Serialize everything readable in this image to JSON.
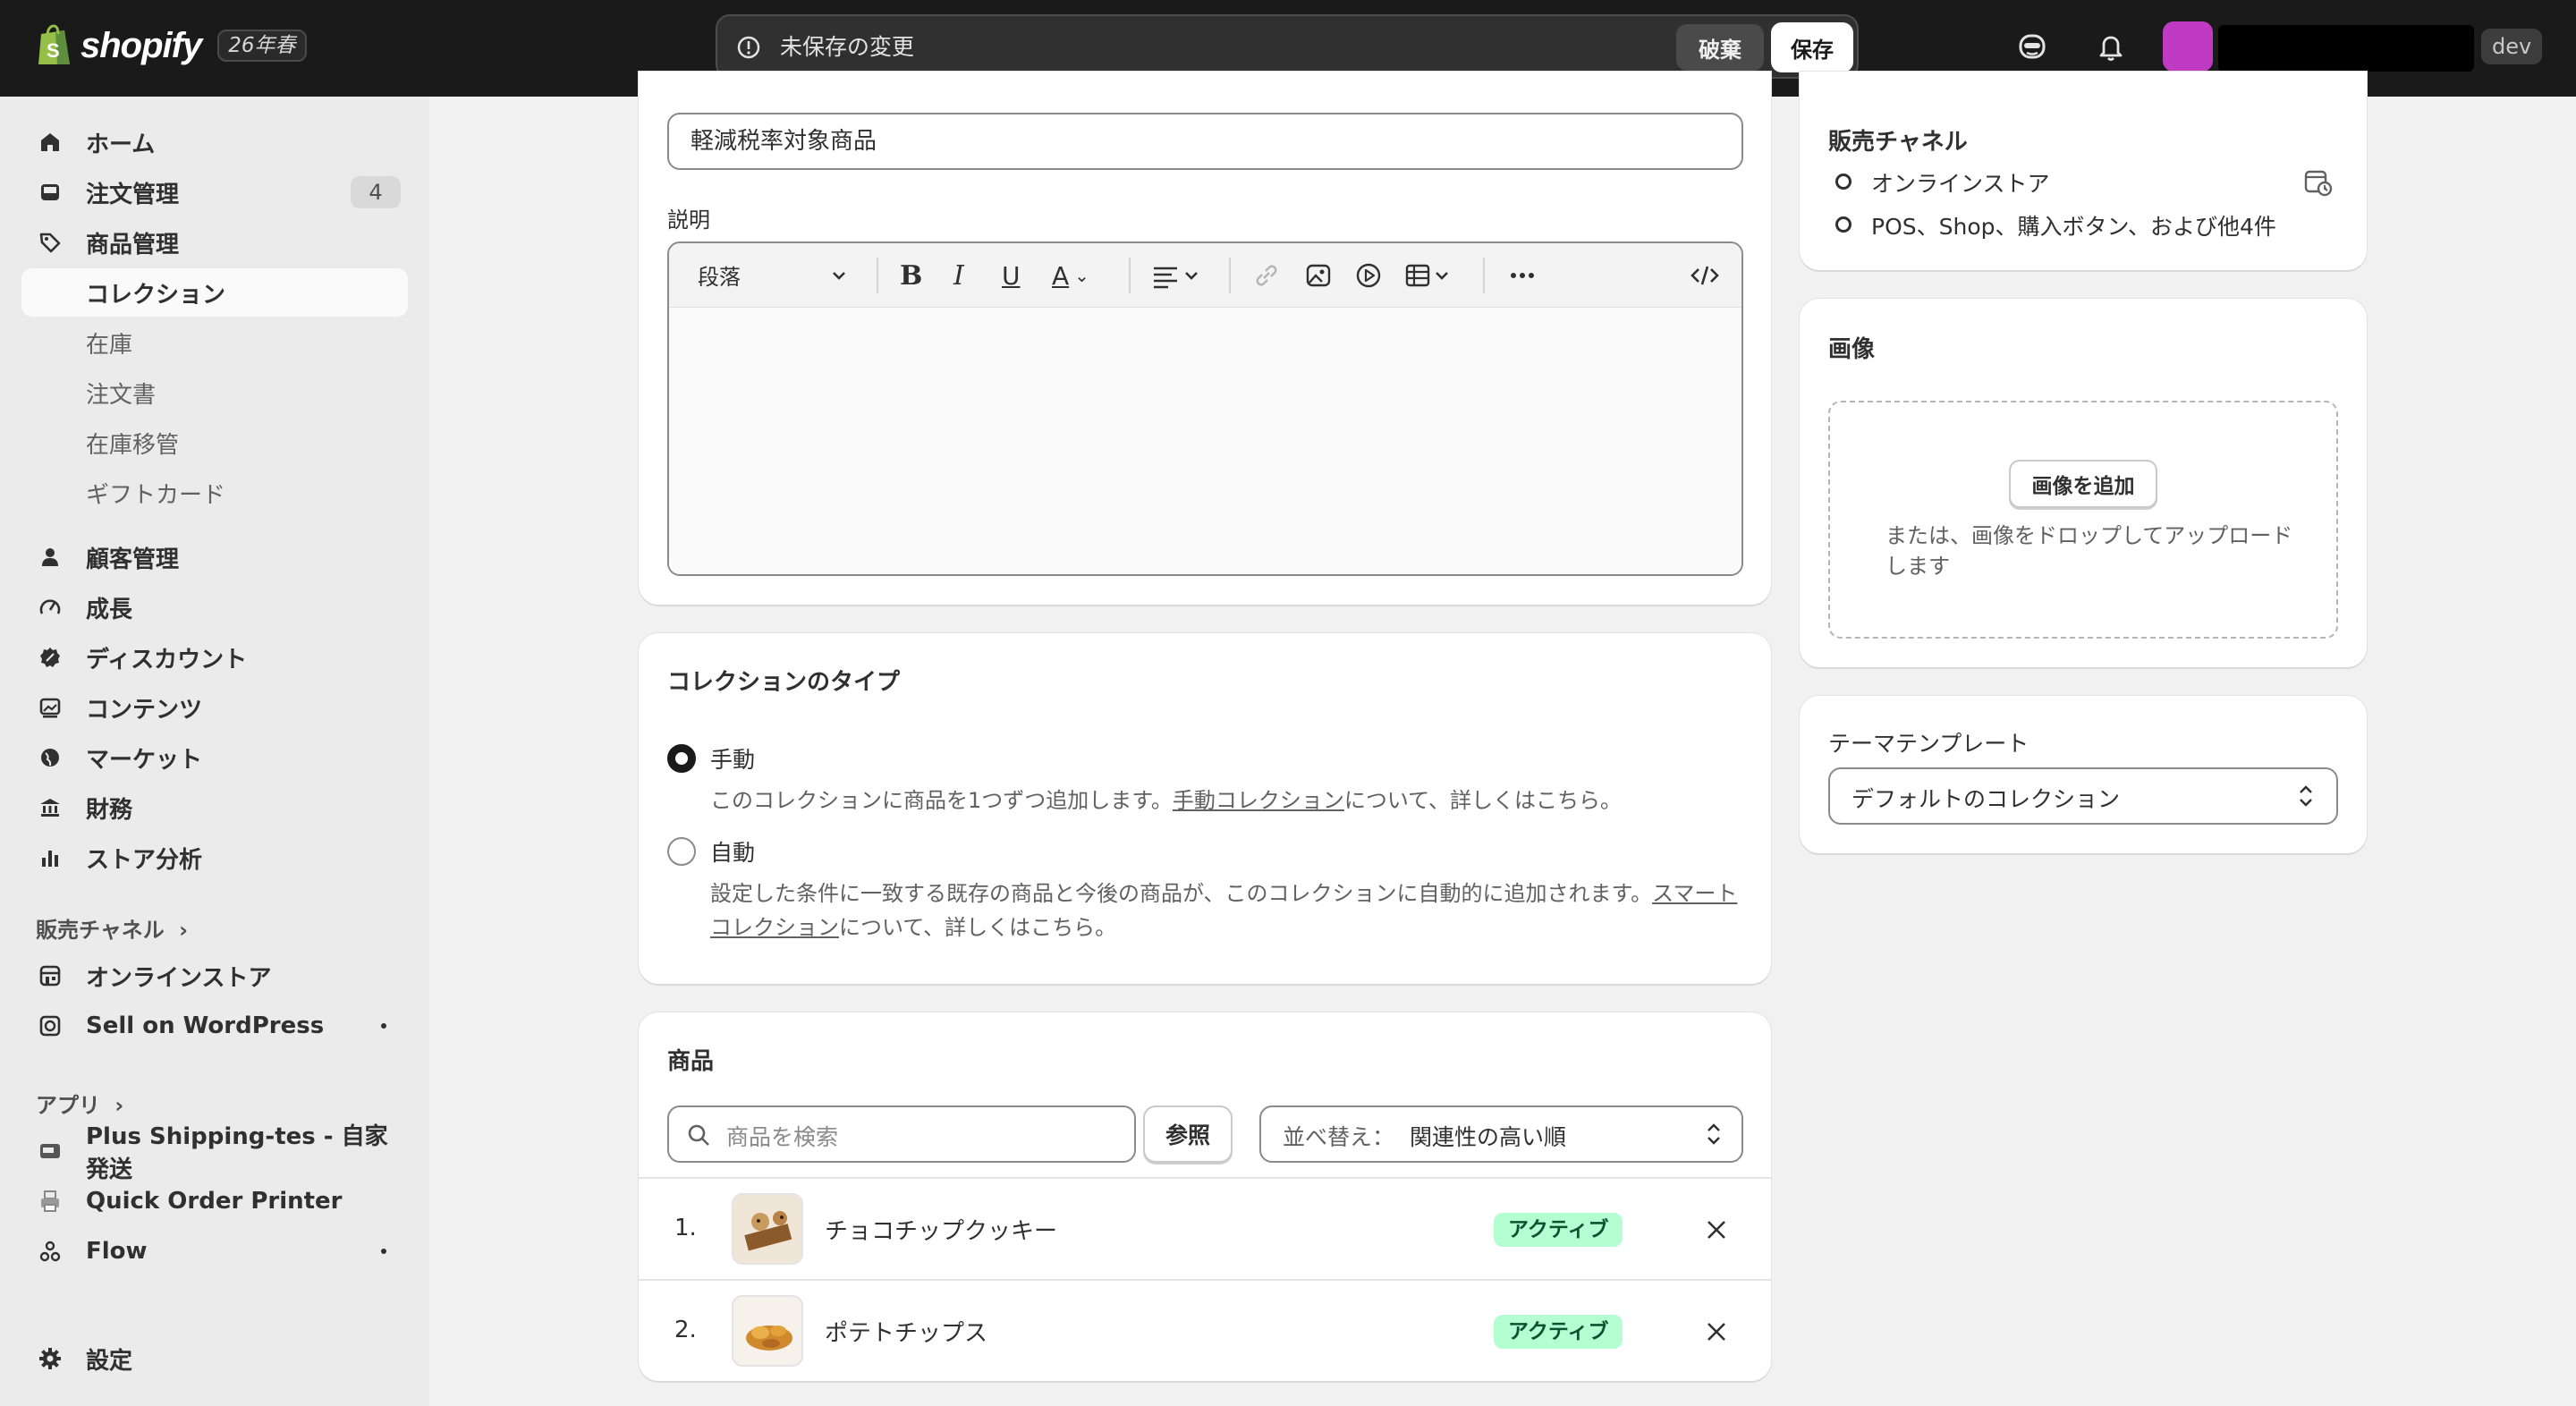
{
  "topbar": {
    "brand": "shopify",
    "edition": "26年春",
    "unsaved_message": "未保存の変更",
    "discard_label": "破棄",
    "save_label": "保存",
    "store_badge": "dev",
    "avatar_color": "#c13ac4"
  },
  "sidebar": {
    "items": [
      {
        "label": "ホーム",
        "icon": "home-icon"
      },
      {
        "label": "注文管理",
        "icon": "inbox-icon",
        "badge": "4"
      },
      {
        "label": "商品管理",
        "icon": "tag-icon"
      },
      {
        "label": "コレクション",
        "active": true
      },
      {
        "label": "在庫"
      },
      {
        "label": "注文書"
      },
      {
        "label": "在庫移管"
      },
      {
        "label": "ギフトカード"
      },
      {
        "label": "顧客管理",
        "icon": "person-icon"
      },
      {
        "label": "成長",
        "icon": "gauge-icon"
      },
      {
        "label": "ディスカウント",
        "icon": "discount-icon"
      },
      {
        "label": "コンテンツ",
        "icon": "image-icon"
      },
      {
        "label": "マーケット",
        "icon": "globe-icon"
      },
      {
        "label": "財務",
        "icon": "bank-icon"
      },
      {
        "label": "ストア分析",
        "icon": "chart-bar-icon"
      }
    ],
    "sales_channels_heading": "販売チャネル",
    "sales_channels": [
      {
        "label": "オンラインストア",
        "icon": "store-icon"
      },
      {
        "label": "Sell on WordPress",
        "icon": "wordpress-icon"
      }
    ],
    "apps_heading": "アプリ",
    "apps": [
      {
        "label": "Plus Shipping-tes - 自家発送",
        "icon": "truck-icon"
      },
      {
        "label": "Quick Order Printer",
        "icon": "printer-icon"
      },
      {
        "label": "Flow",
        "icon": "flow-icon"
      }
    ],
    "settings_label": "設定"
  },
  "main": {
    "title_value": "軽減税率対象商品",
    "description_label": "説明",
    "editor": {
      "format_select": "段落"
    },
    "collection_type": {
      "title": "コレクションのタイプ",
      "manual_label": "手動",
      "manual_help_pre": "このコレクションに商品を1つずつ追加します。",
      "manual_help_link": "手動コレクション",
      "manual_help_post": "について、詳しくはこちら。",
      "auto_label": "自動",
      "auto_help_line1_pre": "設定した条件に一致する既存の商品と今後の商品が、このコレクションに自動的に追加されます。",
      "auto_help_line1_link": "スマート",
      "auto_help_line2_link": "コレクション",
      "auto_help_line2_post": "について、詳しくはこちら。"
    },
    "products": {
      "title": "商品",
      "search_placeholder": "商品を検索",
      "browse_label": "参照",
      "sort_label": "並べ替え：",
      "sort_value": "関連性の高い順",
      "rows": [
        {
          "num": "1.",
          "name": "チョコチップクッキー",
          "status": "アクティブ"
        },
        {
          "num": "2.",
          "name": "ポテトチップス",
          "status": "アクティブ"
        }
      ]
    }
  },
  "right": {
    "sales_channels_title": "販売チャネル",
    "channels": [
      "オンラインストア",
      "POS、Shop、購入ボタン、および他4件"
    ],
    "image_title": "画像",
    "add_image_label": "画像を追加",
    "drop_text": "または、画像をドロップしてアップロードします",
    "theme_template_label": "テーマテンプレート",
    "theme_template_value": "デフォルトのコレクション"
  },
  "colors": {
    "topbar": "#1a1a1a",
    "sidebar": "#ebebeb",
    "active_badge_bg": "#b4fed2",
    "active_badge_text": "#0c5132"
  }
}
